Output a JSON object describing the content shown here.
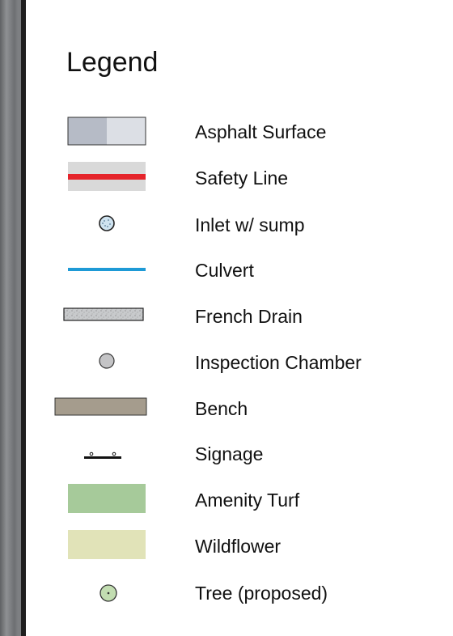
{
  "legend": {
    "title": "Legend",
    "items": [
      {
        "label": "Asphalt Surface",
        "symbol": "asphalt-swatch",
        "colors": [
          "#b6bbc6",
          "#dcdfe5"
        ]
      },
      {
        "label": "Safety Line",
        "symbol": "safety-line-swatch",
        "colors": [
          "#d9d9d9",
          "#e5242b"
        ]
      },
      {
        "label": "Inlet w/ sump",
        "symbol": "inlet-sump-icon",
        "colors": [
          "#cfe3f0",
          "#222222"
        ]
      },
      {
        "label": "Culvert",
        "symbol": "culvert-line-swatch",
        "colors": [
          "#1e9ad6"
        ]
      },
      {
        "label": "French Drain",
        "symbol": "french-drain-swatch",
        "colors": [
          "#c8cacc",
          "#222222"
        ]
      },
      {
        "label": "Inspection Chamber",
        "symbol": "inspection-chamber-icon",
        "colors": [
          "#c4c4c6",
          "#333333"
        ]
      },
      {
        "label": "Bench",
        "symbol": "bench-swatch",
        "colors": [
          "#a59c8d",
          "#333333"
        ]
      },
      {
        "label": "Signage",
        "symbol": "signage-icon",
        "colors": [
          "#111111"
        ]
      },
      {
        "label": "Amenity Turf",
        "symbol": "amenity-turf-swatch",
        "colors": [
          "#a6ca9a"
        ]
      },
      {
        "label": "Wildflower",
        "symbol": "wildflower-swatch",
        "colors": [
          "#e1e3b8"
        ]
      },
      {
        "label": "Tree (proposed)",
        "symbol": "tree-proposed-icon",
        "colors": [
          "#c2ddb1",
          "#333333"
        ]
      }
    ]
  }
}
